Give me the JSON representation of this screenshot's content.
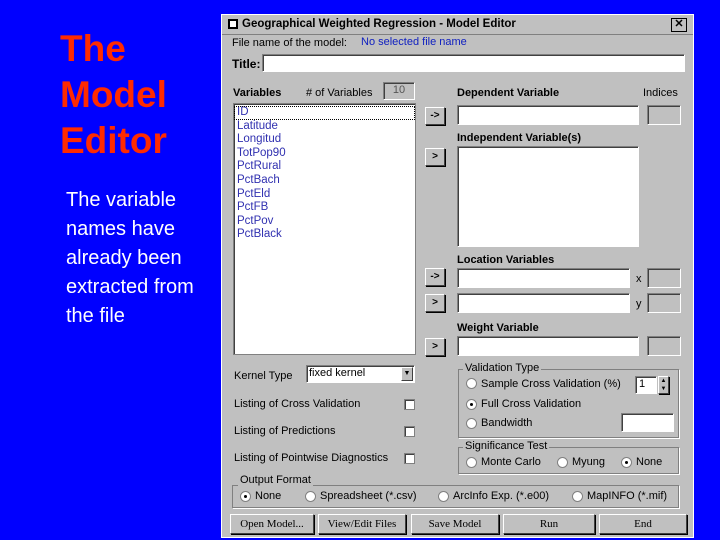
{
  "slide": {
    "title_lines": [
      "The",
      "Model",
      "Editor"
    ],
    "body": "The variable names have already been extracted from the file"
  },
  "window": {
    "title": "Geographical Weighted Regression - Model Editor",
    "close_label": "✕",
    "file_name_label": "File name of the model:",
    "file_name_value": "No selected file name",
    "title_label": "Title:",
    "title_value": "",
    "variables_label": "Variables",
    "num_vars_label": "# of Variables",
    "num_vars_value": "10",
    "variables": [
      "ID",
      "Latitude",
      "Longitud",
      "TotPop90",
      "PctRural",
      "PctBach",
      "PctEld",
      "PctFB",
      "PctPov",
      "PctBlack"
    ],
    "dependent_label": "Dependent Variable",
    "indices_label": "Indices",
    "independent_label": "Independent Variable(s)",
    "location_label": "Location Variables",
    "x_label": "x",
    "y_label": "y",
    "weight_label": "Weight Variable",
    "arrow_right": "->",
    "arrow_single": ">",
    "kernel_label": "Kernel Type",
    "kernel_value": "fixed kernel",
    "listing_cv_label": "Listing of Cross Validation",
    "listing_pred_label": "Listing of Predictions",
    "listing_pw_label": "Listing of Pointwise Diagnostics",
    "validation": {
      "title": "Validation Type",
      "opt1": "Sample Cross Validation (%)",
      "opt1_value": "1",
      "opt2": "Full Cross Validation",
      "opt3": "Bandwidth"
    },
    "significance": {
      "title": "Significance Test",
      "opt1": "Monte Carlo",
      "opt2": "Myung",
      "opt3": "None"
    },
    "output": {
      "title": "Output Format",
      "opt1": "None",
      "opt2": "Spreadsheet (*.csv)",
      "opt3": "ArcInfo Exp. (*.e00)",
      "opt4": "MapINFO (*.mif)"
    },
    "buttons": {
      "open": "Open Model...",
      "view_edit": "View/Edit Files",
      "save": "Save Model",
      "run": "Run",
      "end": "End"
    }
  }
}
